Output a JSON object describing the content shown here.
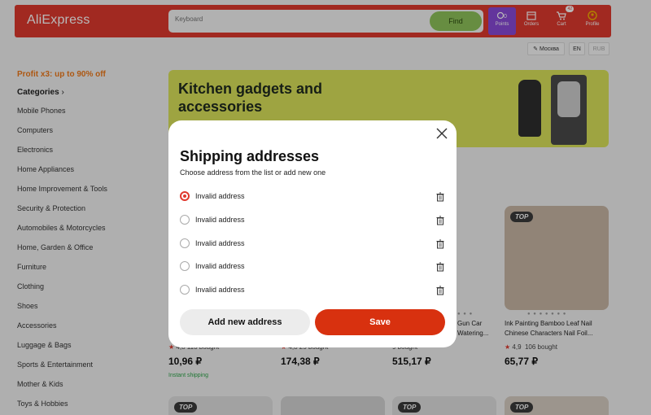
{
  "header": {
    "logo": "AliExpress",
    "search_placeholder": "Keyboard",
    "find_label": "Find",
    "items": [
      {
        "label": "Points",
        "icon": "points-icon",
        "badge_text": "0"
      },
      {
        "label": "Orders",
        "icon": "orders-icon"
      },
      {
        "label": "Cart",
        "icon": "cart-icon",
        "badge": "42"
      },
      {
        "label": "Profile",
        "icon": "profile-icon"
      }
    ],
    "location": "Москва",
    "lang_en": "EN",
    "currency": "RUB"
  },
  "sidebar": {
    "promo": "Profit x3: up to 90% off",
    "categories_label": "Categories",
    "categories": [
      "Mobile Phones",
      "Computers",
      "Electronics",
      "Home Appliances",
      "Home Improvement & Tools",
      "Security & Protection",
      "Automobiles & Motorcycles",
      "Home, Garden & Office",
      "Furniture",
      "Clothing",
      "Shoes",
      "Accessories",
      "Luggage & Bags",
      "Sports & Entertainment",
      "Mother & Kids",
      "Toys & Hobbies"
    ]
  },
  "banner": {
    "title": "Kitchen gadgets and accessories"
  },
  "products": [
    {
      "rating_partial": "4,8",
      "bought_partial": "113 bought",
      "price": "10,96 ₽",
      "shipping": "Instant shipping"
    },
    {
      "rating_partial": "4,8",
      "bought_partial": "25 bought",
      "price": "174,38 ₽"
    },
    {
      "title_line1": "Gun Car",
      "title_line2": "Watering...",
      "bought_partial": "9 bought",
      "price": "515,17 ₽"
    },
    {
      "title_line1": "Ink Painting Bamboo Leaf Nail",
      "title_line2": "Chinese Characters Nail Foil...",
      "rating": "4,9",
      "bought": "106 bought",
      "price": "65,77 ₽",
      "badge": "TOP"
    }
  ],
  "bottom_badges": [
    "TOP",
    "TOP",
    "TOP"
  ],
  "modal": {
    "title": "Shipping addresses",
    "subtitle": "Choose address from the list or add new one",
    "addresses": [
      {
        "label": "Invalid address",
        "selected": true
      },
      {
        "label": "Invalid address",
        "selected": false
      },
      {
        "label": "Invalid address",
        "selected": false
      },
      {
        "label": "Invalid address",
        "selected": false
      },
      {
        "label": "Invalid address",
        "selected": false
      }
    ],
    "add_label": "Add new address",
    "save_label": "Save"
  },
  "colors": {
    "brand": "#e0392e",
    "save": "#d8310f",
    "promo": "#f07a1b",
    "banner": "#dce35a",
    "shipping": "#2fa64b"
  }
}
